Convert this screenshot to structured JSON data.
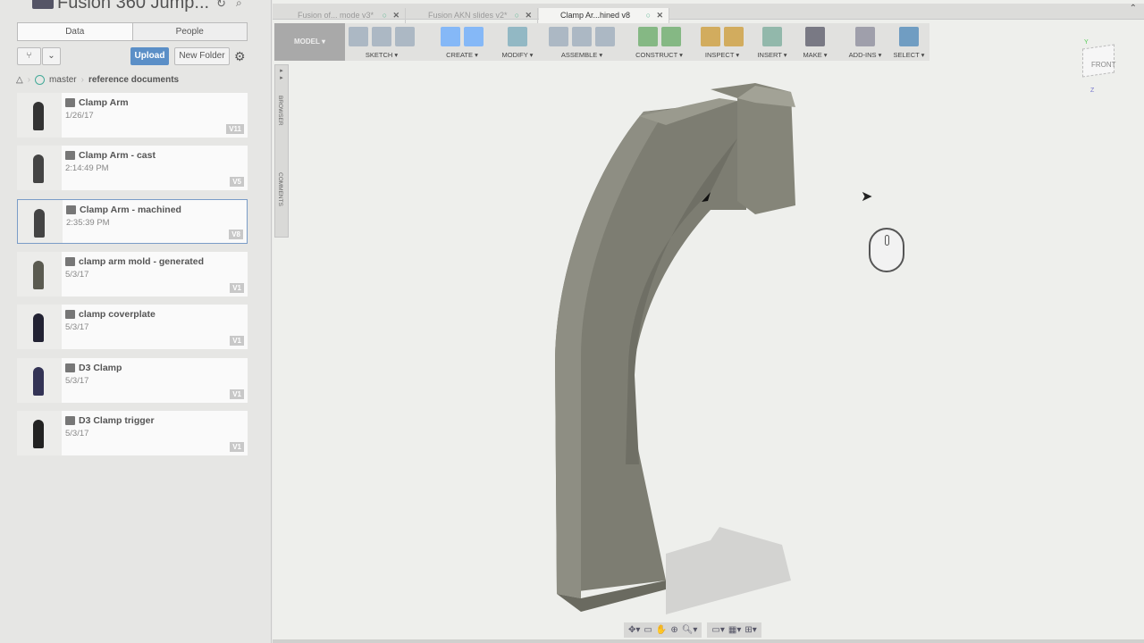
{
  "panel": {
    "title": "Fusion 360 Jump...",
    "tabs": [
      "Data",
      "People"
    ],
    "upload": "Upload",
    "new_folder": "New Folder",
    "breadcrumb": [
      "master",
      "reference documents"
    ],
    "items": [
      {
        "name": "Clamp Arm",
        "date": "1/26/17",
        "version": "V11"
      },
      {
        "name": "Clamp Arm - cast",
        "date": "2:14:49 PM",
        "version": "V5"
      },
      {
        "name": "Clamp Arm - machined",
        "date": "2:35:39 PM",
        "version": "V8",
        "selected": true
      },
      {
        "name": "clamp arm mold - generated",
        "date": "5/3/17",
        "version": "V1"
      },
      {
        "name": "clamp coverplate",
        "date": "5/3/17",
        "version": "V1"
      },
      {
        "name": "D3 Clamp",
        "date": "5/3/17",
        "version": "V1"
      },
      {
        "name": "D3 Clamp trigger",
        "date": "5/3/17",
        "version": "V1"
      }
    ]
  },
  "doc_tabs": [
    {
      "label": "Fusion of... mode v3*"
    },
    {
      "label": "Fusion AKN slides v2*"
    },
    {
      "label": "Clamp Ar...hined v8",
      "active": true
    }
  ],
  "toolbar": {
    "workspace": "MODEL ▾",
    "groups": [
      "SKETCH ▾",
      "CREATE ▾",
      "MODIFY ▾",
      "ASSEMBLE ▾",
      "CONSTRUCT ▾",
      "INSPECT ▾",
      "INSERT ▾",
      "MAKE ▾",
      "ADD-INS ▾",
      "SELECT ▾"
    ]
  },
  "side": {
    "browser": "BROWSER",
    "comments": "COMMENTS"
  },
  "viewcube": {
    "face": "FRONT",
    "axes": [
      "Y",
      "Z"
    ]
  },
  "colors": {
    "accent": "#5b8fc7",
    "select_active": "#4a86b8"
  }
}
